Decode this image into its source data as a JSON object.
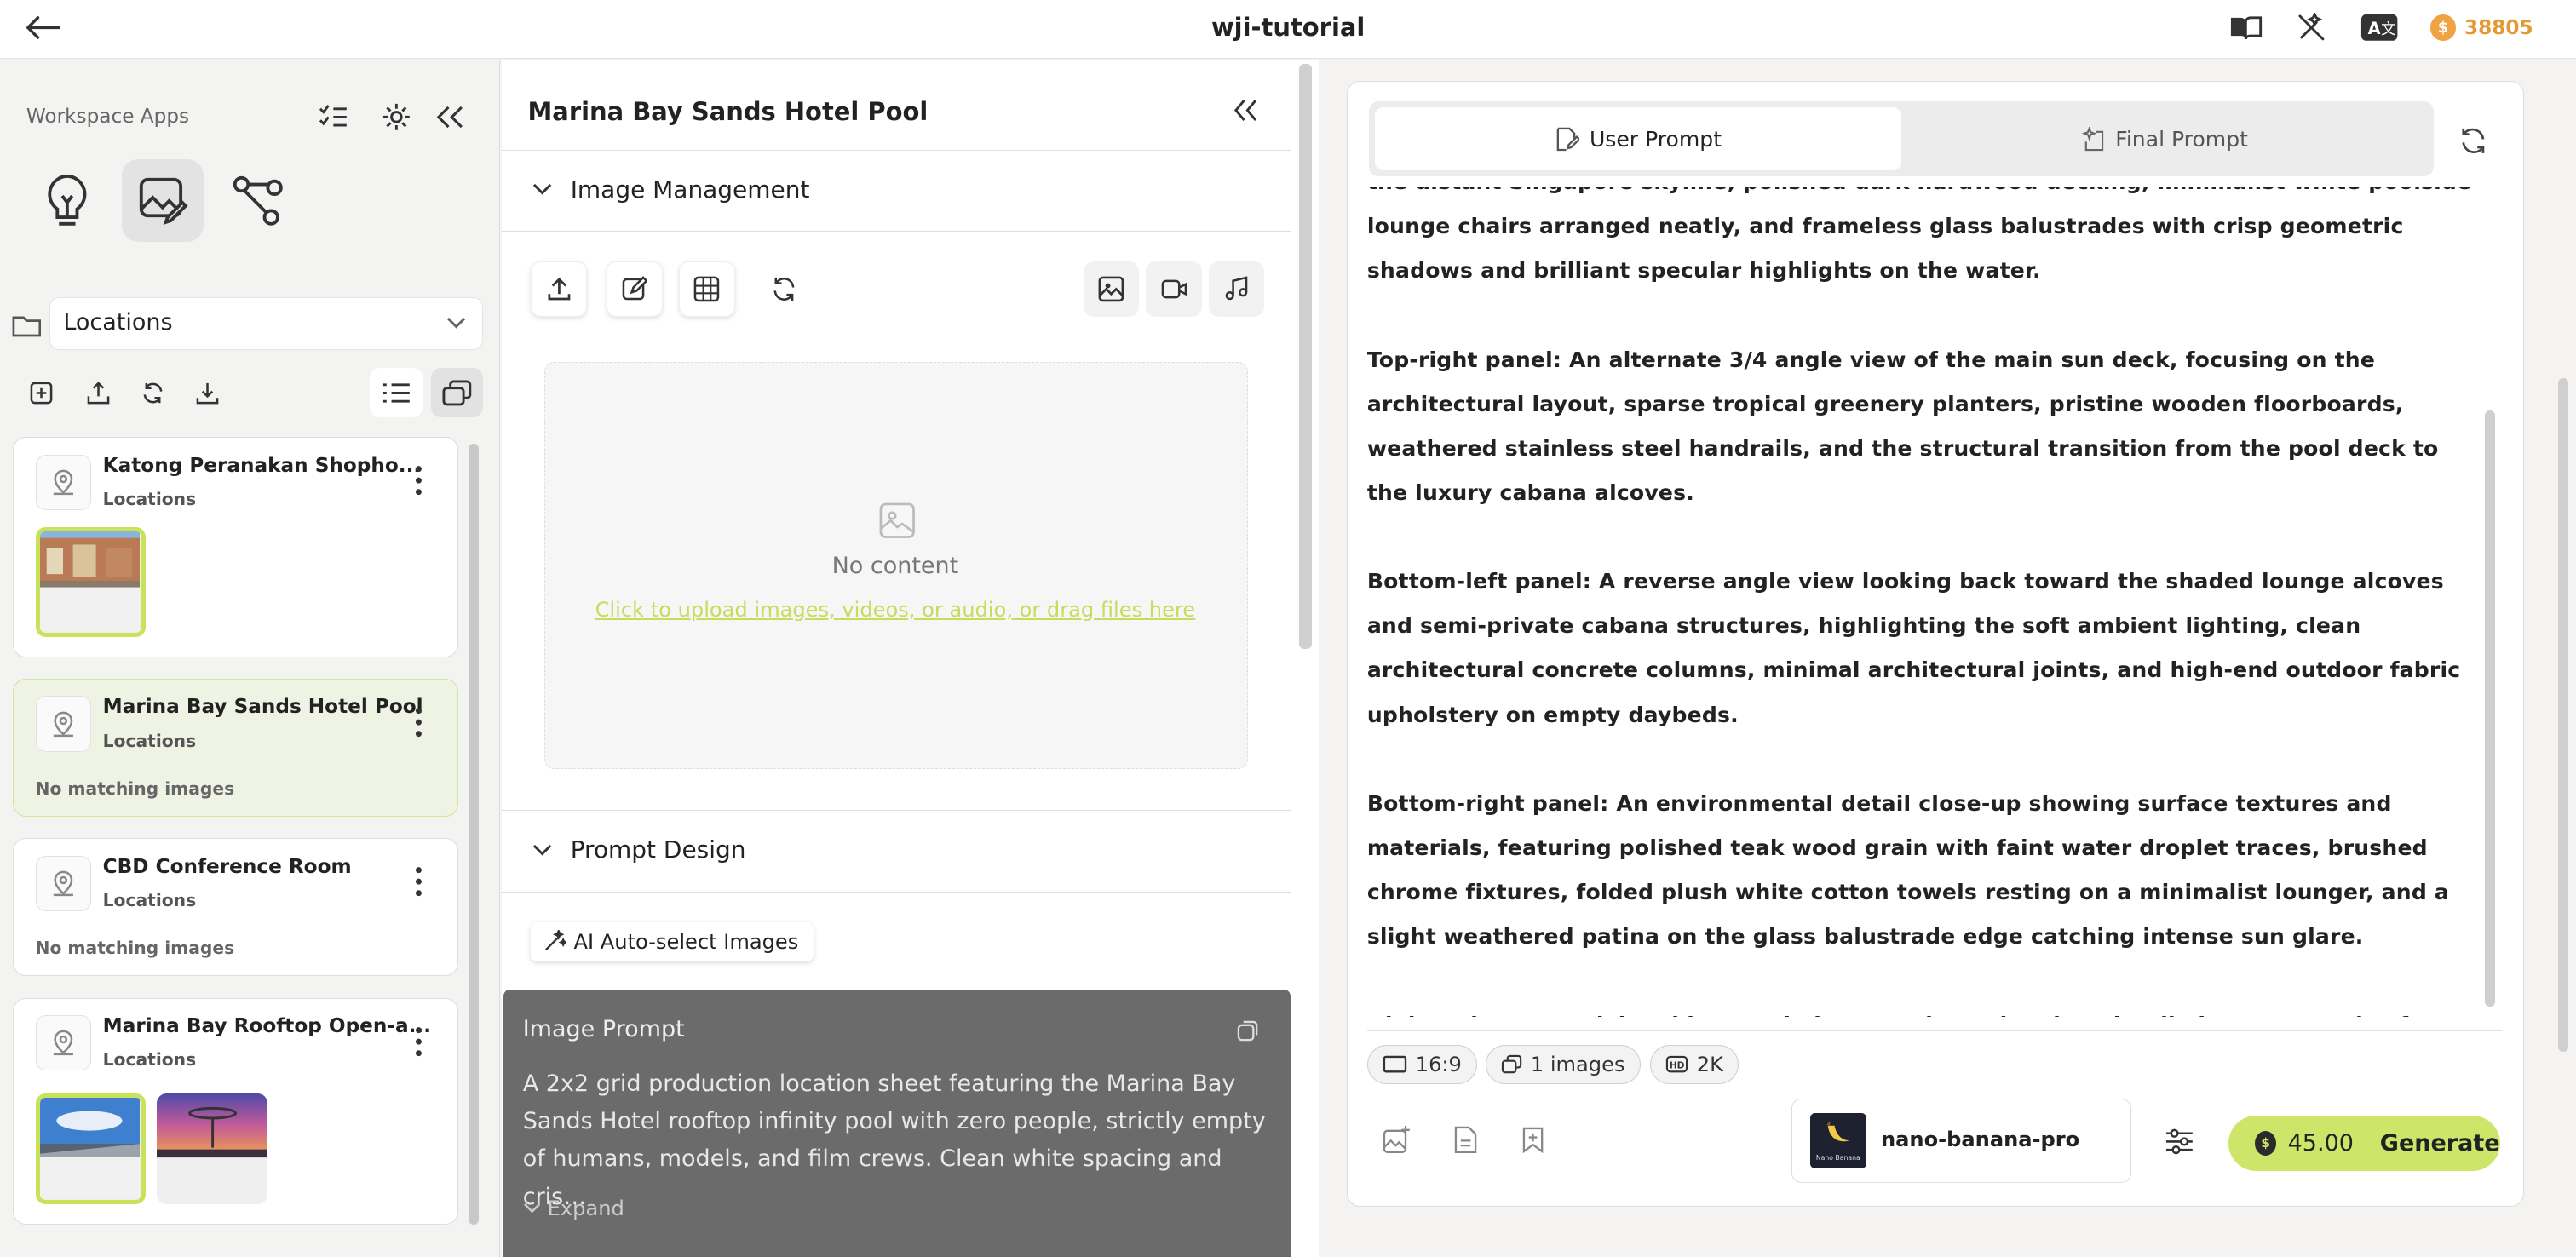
{
  "topbar": {
    "title": "wji-tutorial",
    "credits": "38805",
    "coin_symbol": "$"
  },
  "left": {
    "header": "Workspace Apps",
    "folder_select": "Locations",
    "cards": [
      {
        "name": "Katong Peranakan Shopho...",
        "category": "Locations",
        "images": [
          "street"
        ]
      },
      {
        "name": "Marina Bay Sands Hotel Pool",
        "category": "Locations",
        "note": "No matching images"
      },
      {
        "name": "CBD Conference Room",
        "category": "Locations",
        "note": "No matching images"
      },
      {
        "name": "Marina Bay Rooftop Open-a...",
        "category": "Locations",
        "images": [
          "rooftop-day",
          "rooftop-sunset"
        ]
      }
    ]
  },
  "mid": {
    "title": "Marina Bay Sands Hotel Pool",
    "image_management": "Image Management",
    "no_content": "No content",
    "upload_hint": "Click to upload images, videos, or audio, or drag files here",
    "prompt_design": "Prompt Design",
    "ai_select": "AI Auto-select Images",
    "image_prompt_label": "Image Prompt",
    "image_prompt_text": "A 2x2 grid production location sheet featuring the Marina Bay Sands Hotel rooftop infinity pool with zero people, strictly empty of humans, models, and film crews. Clean white spacing and cris…",
    "expand": "Expand"
  },
  "right": {
    "tab_user": "User Prompt",
    "tab_final": "Final Prompt",
    "paragraphs": [
      "the distant Singapore skyline, polished dark hardwood decking, minimalist white poolside lounge chairs arranged neatly, and frameless glass balustrades with crisp geometric shadows and brilliant specular highlights on the water.",
      "Top-right panel: An alternate 3/4 angle view of the main sun deck, focusing on the architectural layout, sparse tropical greenery planters, pristine wooden floorboards, weathered stainless steel handrails, and the structural transition from the pool deck to the luxury cabana alcoves.",
      "Bottom-left panel: A reverse angle view looking back toward the shaded lounge alcoves and semi-private cabana structures, highlighting the soft ambient lighting, clean architectural concrete columns, minimal architectural joints, and high-end outdoor fabric upholstery on empty daybeds.",
      "Bottom-right panel: An environmental detail close-up showing surface textures and materials, featuring polished teak wood grain with faint water droplet traces, brushed chrome fixtures, folded plush white cotton towels resting on a minimalist lounger, and a slight weathered patina on the glass balustrade edge catching intense sun glare.",
      "High-end commercial architectural photography style, ultra-detailed textures, crisp focus, photorealistic lighting, cinematic production design location sheet."
    ],
    "chips": {
      "ratio": "16:9",
      "images": "1 images",
      "res": "2K"
    },
    "model": "nano-banana-pro",
    "model_logo_text": "Nano Banana",
    "price": "45.00",
    "generate": "Generate"
  },
  "colors": {
    "accent": "#cde66a",
    "credits": "#e39a33"
  }
}
